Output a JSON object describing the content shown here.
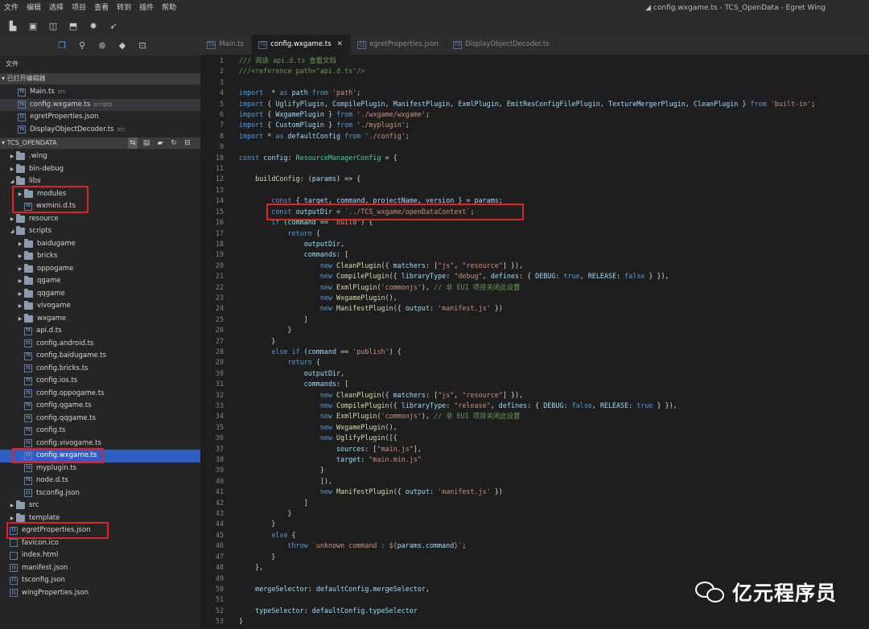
{
  "menu": [
    "文件",
    "编辑",
    "选择",
    "项目",
    "查看",
    "转到",
    "插件",
    "帮助"
  ],
  "window_title": "config.wxgame.ts - TCS_OpenData - Egret Wing",
  "sidebar": {
    "label": "文件",
    "open_editors_title": "已打开编辑器",
    "open_editors": [
      {
        "name": "Main.ts",
        "desc": "src"
      },
      {
        "name": "config.wxgame.ts",
        "desc": "scripts"
      },
      {
        "name": "egretProperties.json",
        "desc": ""
      },
      {
        "name": "DisplayObjectDecoder.ts",
        "desc": "src"
      }
    ],
    "project_title": "TCS_OPENDATA",
    "tree": [
      {
        "name": ".wing",
        "type": "dir",
        "depth": 0,
        "open": false
      },
      {
        "name": "bin-debug",
        "type": "dir",
        "depth": 0,
        "open": false
      },
      {
        "name": "libs",
        "type": "dir",
        "depth": 0,
        "open": true
      },
      {
        "name": "modules",
        "type": "dir",
        "depth": 1,
        "open": false
      },
      {
        "name": "wxmini.d.ts",
        "type": "file",
        "depth": 1
      },
      {
        "name": "resource",
        "type": "dir",
        "depth": 0,
        "open": false
      },
      {
        "name": "scripts",
        "type": "dir",
        "depth": 0,
        "open": true
      },
      {
        "name": "baidugame",
        "type": "dir",
        "depth": 1,
        "open": false
      },
      {
        "name": "bricks",
        "type": "dir",
        "depth": 1,
        "open": false
      },
      {
        "name": "oppogame",
        "type": "dir",
        "depth": 1,
        "open": false
      },
      {
        "name": "qgame",
        "type": "dir",
        "depth": 1,
        "open": false
      },
      {
        "name": "qqgame",
        "type": "dir",
        "depth": 1,
        "open": false
      },
      {
        "name": "vivogame",
        "type": "dir",
        "depth": 1,
        "open": false
      },
      {
        "name": "wxgame",
        "type": "dir",
        "depth": 1,
        "open": false
      },
      {
        "name": "api.d.ts",
        "type": "file",
        "depth": 1
      },
      {
        "name": "config.android.ts",
        "type": "file",
        "depth": 1
      },
      {
        "name": "config.baidugame.ts",
        "type": "file",
        "depth": 1
      },
      {
        "name": "config.bricks.ts",
        "type": "file",
        "depth": 1
      },
      {
        "name": "config.ios.ts",
        "type": "file",
        "depth": 1
      },
      {
        "name": "config.oppogame.ts",
        "type": "file",
        "depth": 1
      },
      {
        "name": "config.qgame.ts",
        "type": "file",
        "depth": 1
      },
      {
        "name": "config.qqgame.ts",
        "type": "file",
        "depth": 1
      },
      {
        "name": "config.ts",
        "type": "file",
        "depth": 1
      },
      {
        "name": "config.vivogame.ts",
        "type": "file",
        "depth": 1
      },
      {
        "name": "config.wxgame.ts",
        "type": "file",
        "depth": 1,
        "selected": true
      },
      {
        "name": "myplugin.ts",
        "type": "file",
        "depth": 1
      },
      {
        "name": "node.d.ts",
        "type": "file",
        "depth": 1
      },
      {
        "name": "tsconfig.json",
        "type": "file",
        "depth": 1
      },
      {
        "name": "src",
        "type": "dir",
        "depth": 0,
        "open": false
      },
      {
        "name": "template",
        "type": "dir",
        "depth": 0,
        "open": false
      },
      {
        "name": "egretProperties.json",
        "type": "file",
        "depth": 0
      },
      {
        "name": "favicon.ico",
        "type": "file",
        "depth": 0
      },
      {
        "name": "index.html",
        "type": "file",
        "depth": 0
      },
      {
        "name": "manifest.json",
        "type": "file",
        "depth": 0
      },
      {
        "name": "tsconfig.json",
        "type": "file",
        "depth": 0
      },
      {
        "name": "wingProperties.json",
        "type": "file",
        "depth": 0
      }
    ]
  },
  "tabs": [
    {
      "label": "Main.ts",
      "active": false
    },
    {
      "label": "config.wxgame.ts",
      "active": true
    },
    {
      "label": "egretProperties.json",
      "active": false
    },
    {
      "label": "DisplayObjectDecoder.ts",
      "active": false
    }
  ],
  "code": [
    [
      [
        "cm",
        "/// 阅读 api.d.ts 查看文档"
      ]
    ],
    [
      [
        "cm",
        "///<reference path=\"api.d.ts\"/>"
      ]
    ],
    [],
    [
      [
        "kw",
        "import"
      ],
      [
        "",
        "  * "
      ],
      [
        "kw",
        "as"
      ],
      [
        "",
        " "
      ],
      [
        "var",
        "path"
      ],
      [
        "",
        " "
      ],
      [
        "kw",
        "from"
      ],
      [
        "",
        " "
      ],
      [
        "str",
        "'path'"
      ],
      [
        "",
        ";"
      ]
    ],
    [
      [
        "kw",
        "import"
      ],
      [
        "",
        "",
        " { "
      ],
      [
        "var",
        "UglifyPlugin"
      ],
      [
        "",
        ", "
      ],
      [
        "var",
        "CompilePlugin"
      ],
      [
        "",
        ", "
      ],
      [
        "var",
        "ManifestPlugin"
      ],
      [
        "",
        ", "
      ],
      [
        "var",
        "ExmlPlugin"
      ],
      [
        "",
        ", "
      ],
      [
        "var",
        "EmitResConfigFilePlugin"
      ],
      [
        "",
        ", "
      ],
      [
        "var",
        "TextureMergerPlugin"
      ],
      [
        "",
        ", "
      ],
      [
        "var",
        "CleanPlugin"
      ],
      [
        "",
        " } "
      ],
      [
        "kw",
        "from"
      ],
      [
        "",
        " "
      ],
      [
        "str",
        "'built-in'"
      ],
      [
        "",
        ";"
      ]
    ],
    [
      [
        "kw",
        "import"
      ],
      [
        "",
        " { "
      ],
      [
        "var",
        "WxgamePlugin"
      ],
      [
        "",
        " } "
      ],
      [
        "kw",
        "from"
      ],
      [
        "",
        " "
      ],
      [
        "str",
        "'./wxgame/wxgame'"
      ],
      [
        "",
        ";"
      ]
    ],
    [
      [
        "kw",
        "import"
      ],
      [
        "",
        " { "
      ],
      [
        "var",
        "CustomPlugin"
      ],
      [
        "",
        " } "
      ],
      [
        "kw",
        "from"
      ],
      [
        "",
        " "
      ],
      [
        "str",
        "'./myplugin'"
      ],
      [
        "",
        ";"
      ]
    ],
    [
      [
        "kw",
        "import"
      ],
      [
        "",
        " * "
      ],
      [
        "kw",
        "as"
      ],
      [
        "",
        " "
      ],
      [
        "var",
        "defaultConfig"
      ],
      [
        "",
        " "
      ],
      [
        "kw",
        "from"
      ],
      [
        "",
        " "
      ],
      [
        "str",
        "'./config'"
      ],
      [
        "",
        ";"
      ]
    ],
    [],
    [
      [
        "kw",
        "const"
      ],
      [
        "",
        " "
      ],
      [
        "var",
        "config"
      ],
      [
        "",
        ": "
      ],
      [
        "ty",
        "ResourceManagerConfig"
      ],
      [
        "",
        " = {"
      ]
    ],
    [],
    [
      [
        "",
        "    "
      ],
      [
        "fn",
        "buildConfig"
      ],
      [
        "",
        ": ("
      ],
      [
        "var",
        "params"
      ],
      [
        "",
        ") => {"
      ]
    ],
    [],
    [
      [
        "",
        "        "
      ],
      [
        "kw",
        "const"
      ],
      [
        "",
        " { "
      ],
      [
        "var",
        "target"
      ],
      [
        "",
        ", "
      ],
      [
        "var",
        "command"
      ],
      [
        "",
        ", "
      ],
      [
        "var",
        "projectName"
      ],
      [
        "",
        ", "
      ],
      [
        "var",
        "version"
      ],
      [
        "",
        " } = "
      ],
      [
        "var",
        "params"
      ],
      [
        "",
        ";"
      ]
    ],
    [
      [
        "",
        "        "
      ],
      [
        "kw",
        "const"
      ],
      [
        "",
        " "
      ],
      [
        "var",
        "outputDir"
      ],
      [
        "",
        " = "
      ],
      [
        "str",
        "`../TCS_wxgame/openDataContext`"
      ],
      [
        "",
        ";"
      ]
    ],
    [
      [
        "",
        "        "
      ],
      [
        "kw",
        "if"
      ],
      [
        "",
        " ("
      ],
      [
        "var",
        "command"
      ],
      [
        "",
        " == "
      ],
      [
        "str",
        "'build'"
      ],
      [
        "",
        ") {"
      ]
    ],
    [
      [
        "",
        "            "
      ],
      [
        "kw",
        "return"
      ],
      [
        "",
        " {"
      ]
    ],
    [
      [
        "",
        "                "
      ],
      [
        "var",
        "outputDir"
      ],
      [
        "",
        ","
      ]
    ],
    [
      [
        "",
        "                "
      ],
      [
        "var",
        "commands"
      ],
      [
        "",
        ": ["
      ]
    ],
    [
      [
        "",
        "                    "
      ],
      [
        "kw",
        "new"
      ],
      [
        "",
        " "
      ],
      [
        "fn",
        "CleanPlugin"
      ],
      [
        "",
        "({ "
      ],
      [
        "var",
        "matchers"
      ],
      [
        "",
        ": ["
      ],
      [
        "str",
        "\"js\""
      ],
      [
        "",
        ", "
      ],
      [
        "str",
        "\"resource\""
      ],
      [
        "",
        "] }),"
      ]
    ],
    [
      [
        "",
        "                    "
      ],
      [
        "kw",
        "new"
      ],
      [
        "",
        " "
      ],
      [
        "fn",
        "CompilePlugin"
      ],
      [
        "",
        "({ "
      ],
      [
        "var",
        "libraryType"
      ],
      [
        "",
        ": "
      ],
      [
        "str",
        "\"debug\""
      ],
      [
        "",
        ", "
      ],
      [
        "var",
        "defines"
      ],
      [
        "",
        ": { "
      ],
      [
        "var",
        "DEBUG"
      ],
      [
        "",
        ": "
      ],
      [
        "nu",
        "true"
      ],
      [
        "",
        ", "
      ],
      [
        "var",
        "RELEASE"
      ],
      [
        "",
        ": "
      ],
      [
        "nu",
        "false"
      ],
      [
        "",
        " } }),"
      ]
    ],
    [
      [
        "",
        "                    "
      ],
      [
        "kw",
        "new"
      ],
      [
        "",
        " "
      ],
      [
        "fn",
        "ExmlPlugin"
      ],
      [
        "",
        "("
      ],
      [
        "str",
        "'commonjs'"
      ],
      [
        "",
        "), "
      ],
      [
        "cm",
        "// 非 EUI 项目关闭此设置"
      ]
    ],
    [
      [
        "",
        "                    "
      ],
      [
        "kw",
        "new"
      ],
      [
        "",
        " "
      ],
      [
        "fn",
        "WxgamePlugin"
      ],
      [
        "",
        "(),"
      ]
    ],
    [
      [
        "",
        "                    "
      ],
      [
        "kw",
        "new"
      ],
      [
        "",
        " "
      ],
      [
        "fn",
        "ManifestPlugin"
      ],
      [
        "",
        "({ "
      ],
      [
        "var",
        "output"
      ],
      [
        "",
        ": "
      ],
      [
        "str",
        "'manifest.js'"
      ],
      [
        "",
        " })"
      ]
    ],
    [
      [
        "",
        "                ]"
      ]
    ],
    [
      [
        "",
        "            }"
      ]
    ],
    [
      [
        "",
        "        }"
      ]
    ],
    [
      [
        "",
        "        "
      ],
      [
        "kw",
        "else if"
      ],
      [
        "",
        " ("
      ],
      [
        "var",
        "command"
      ],
      [
        "",
        " == "
      ],
      [
        "str",
        "'publish'"
      ],
      [
        "",
        ") {"
      ]
    ],
    [
      [
        "",
        "            "
      ],
      [
        "kw",
        "return"
      ],
      [
        "",
        " {"
      ]
    ],
    [
      [
        "",
        "                "
      ],
      [
        "var",
        "outputDir"
      ],
      [
        "",
        ","
      ]
    ],
    [
      [
        "",
        "                "
      ],
      [
        "var",
        "commands"
      ],
      [
        "",
        ": ["
      ]
    ],
    [
      [
        "",
        "                    "
      ],
      [
        "kw",
        "new"
      ],
      [
        "",
        " "
      ],
      [
        "fn",
        "CleanPlugin"
      ],
      [
        "",
        "({ "
      ],
      [
        "var",
        "matchers"
      ],
      [
        "",
        ": ["
      ],
      [
        "str",
        "\"js\""
      ],
      [
        "",
        ", "
      ],
      [
        "str",
        "\"resource\""
      ],
      [
        "",
        "] }),"
      ]
    ],
    [
      [
        "",
        "                    "
      ],
      [
        "kw",
        "new"
      ],
      [
        "",
        " "
      ],
      [
        "fn",
        "CompilePlugin"
      ],
      [
        "",
        "({ "
      ],
      [
        "var",
        "libraryType"
      ],
      [
        "",
        ": "
      ],
      [
        "str",
        "\"release\""
      ],
      [
        "",
        ", "
      ],
      [
        "var",
        "defines"
      ],
      [
        "",
        ": { "
      ],
      [
        "var",
        "DEBUG"
      ],
      [
        "",
        ": "
      ],
      [
        "nu",
        "false"
      ],
      [
        "",
        ", "
      ],
      [
        "var",
        "RELEASE"
      ],
      [
        "",
        ": "
      ],
      [
        "nu",
        "true"
      ],
      [
        "",
        " } }),"
      ]
    ],
    [
      [
        "",
        "                    "
      ],
      [
        "kw",
        "new"
      ],
      [
        "",
        " "
      ],
      [
        "fn",
        "ExmlPlugin"
      ],
      [
        "",
        "("
      ],
      [
        "str",
        "'commonjs'"
      ],
      [
        "",
        "), "
      ],
      [
        "cm",
        "// 非 EUI 项目关闭此设置"
      ]
    ],
    [
      [
        "",
        "                    "
      ],
      [
        "kw",
        "new"
      ],
      [
        "",
        " "
      ],
      [
        "fn",
        "WxgamePlugin"
      ],
      [
        "",
        "(),"
      ]
    ],
    [
      [
        "",
        "                    "
      ],
      [
        "kw",
        "new"
      ],
      [
        "",
        " "
      ],
      [
        "fn",
        "UglifyPlugin"
      ],
      [
        "",
        "([{"
      ]
    ],
    [
      [
        "",
        "                        "
      ],
      [
        "var",
        "sources"
      ],
      [
        "",
        ": ["
      ],
      [
        "str",
        "\"main.js\""
      ],
      [
        "",
        "],"
      ]
    ],
    [
      [
        "",
        "                        "
      ],
      [
        "var",
        "target"
      ],
      [
        "",
        ": "
      ],
      [
        "str",
        "\"main.min.js\""
      ]
    ],
    [
      [
        "",
        "                    }"
      ]
    ],
    [
      [
        "",
        "                    ]),"
      ]
    ],
    [
      [
        "",
        "                    "
      ],
      [
        "kw",
        "new"
      ],
      [
        "",
        " "
      ],
      [
        "fn",
        "ManifestPlugin"
      ],
      [
        "",
        "({ "
      ],
      [
        "var",
        "output"
      ],
      [
        "",
        ": "
      ],
      [
        "str",
        "'manifest.js'"
      ],
      [
        "",
        " })"
      ]
    ],
    [
      [
        "",
        "                ]"
      ]
    ],
    [
      [
        "",
        "            }"
      ]
    ],
    [
      [
        "",
        "        }"
      ]
    ],
    [
      [
        "",
        "        "
      ],
      [
        "kw",
        "else"
      ],
      [
        "",
        " {"
      ]
    ],
    [
      [
        "",
        "            "
      ],
      [
        "kw",
        "throw"
      ],
      [
        "",
        " "
      ],
      [
        "str",
        "`unknown command : ${"
      ],
      [
        "var",
        "params.command"
      ],
      [
        "str",
        "}`"
      ],
      [
        "",
        ";"
      ]
    ],
    [
      [
        "",
        "        }"
      ]
    ],
    [
      [
        "",
        "    },"
      ]
    ],
    [],
    [
      [
        "",
        "    "
      ],
      [
        "var",
        "mergeSelector"
      ],
      [
        "",
        ": "
      ],
      [
        "var",
        "defaultConfig"
      ],
      [
        "",
        "."
      ],
      [
        "var",
        "mergeSelector"
      ],
      [
        "",
        ","
      ]
    ],
    [],
    [
      [
        "",
        "    "
      ],
      [
        "var",
        "typeSelector"
      ],
      [
        "",
        ": "
      ],
      [
        "var",
        "defaultConfig"
      ],
      [
        "",
        "."
      ],
      [
        "var",
        "typeSelector"
      ]
    ],
    [
      [
        "",
        "}"
      ]
    ]
  ],
  "watermark": "亿元程序员",
  "colors": {
    "highlight": "#e0202a",
    "selected": "#2f5fbf"
  }
}
